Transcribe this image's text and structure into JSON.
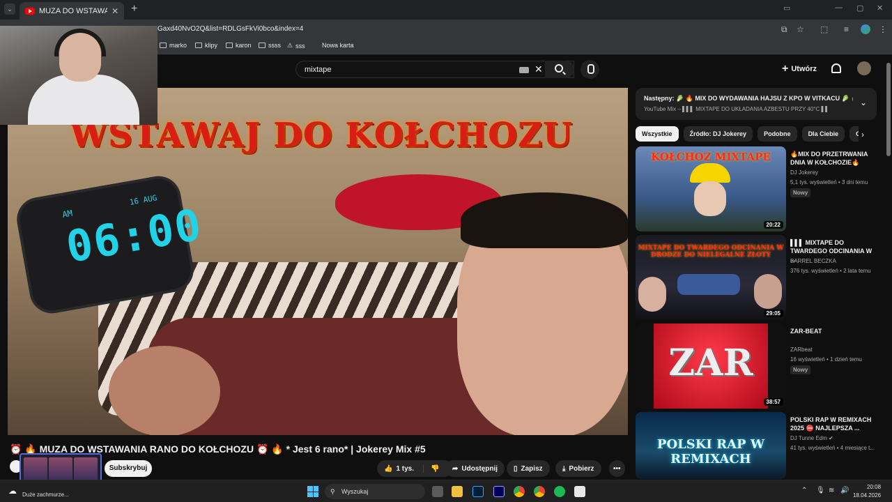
{
  "browser": {
    "tab_title": "MUZA DO WSTAWANIA",
    "url": "Gaxd40NvO2Q&list=RDLGsFkVi0bco&index=4",
    "bookmarks": [
      "marko",
      "klipy",
      "karon",
      "ssss",
      "sss",
      "Nowa karta"
    ]
  },
  "header": {
    "search_value": "mixtape",
    "create_label": "Utwórz"
  },
  "player": {
    "overlay_title": "WSTAWAJ DO KOŁCHOZU",
    "clock_time": "06:00",
    "clock_am": "AM",
    "clock_date": "16 AUG"
  },
  "video": {
    "title": "⏰ 🔥 MUZA DO WSTAWANIA RANO DO KOŁCHOZU ⏰ 🔥 * Jest 6 rano* | Jokerey Mix #5",
    "subscribe_label": "Subskrybuj",
    "like_label": "1 tys.",
    "share_label": "Udostępnij",
    "save_label": "Zapisz",
    "download_label": "Pobierz",
    "more_label": "•••"
  },
  "sidebar": {
    "next": {
      "label": "Następny: 🥬 🔥 MIX DO WYDAWANIA HAJSU Z KPO W VITKACU 🥬 🔥",
      "sub": "YouTube Mix – ▌▌▌ MIXTAPE DO UKŁADANIA AZBESTU PRZY 40°C ▌▌"
    },
    "chips": [
      "Wszystkie",
      "Źródło: DJ Jokerey",
      "Podobne",
      "Dla Ciebie",
      "Ostatnio"
    ],
    "recommendations": [
      {
        "thumb_text": "KOŁCHOZ MIXTAPE",
        "duration": "20:22",
        "title": "🔥MIX DO PRZETRWANIA DNIA W KOŁCHOZIE🔥",
        "channel": "DJ Jokerey",
        "meta": "5,1 tys. wyświetleń • 3 dni temu",
        "badge": "Nowy"
      },
      {
        "thumb_text": "MIXTAPE DO TWARDEGO ODCINANIA W DRODZE DO NIELEGALNE ZŁOTY",
        "duration": "29:05",
        "title": "▌▌▌ MIXTAPE DO TWARDEGO ODCINANIA W ...",
        "channel": "BARREL BECZKA",
        "meta": "376 tys. wyświetleń • 2 lata temu",
        "badge": ""
      },
      {
        "thumb_text": "ZAR",
        "duration": "38:57",
        "title": "ZAR-BEAT",
        "channel": "ZARbeat",
        "meta": "16 wyświetleń • 1 dzień temu",
        "badge": "Nowy"
      },
      {
        "thumb_text": "POLSKI RAP W REMIXACH",
        "duration": "",
        "title": "POLSKI RAP W REMIXACH 2025 ⛔ NAJLEPSZA ...",
        "channel": "DJ Tunne Edm",
        "meta": "41 tys. wyświetleń • 4 miesiące t...",
        "badge": ""
      }
    ]
  },
  "taskbar": {
    "weather": "Duże zachmurze...",
    "search_label": "Wyszukaj",
    "time": "20:08",
    "date": "18.04.2026"
  }
}
